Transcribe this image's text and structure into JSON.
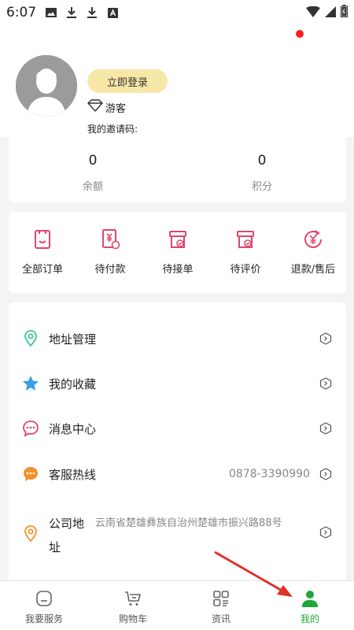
{
  "status_bar": {
    "time": "6:07"
  },
  "profile": {
    "login_label": "立即登录",
    "guest_label": "游客",
    "invite_label": "我的邀请码:"
  },
  "balance": {
    "items": [
      {
        "value": "0",
        "label": "余额"
      },
      {
        "value": "0",
        "label": "积分"
      }
    ]
  },
  "orders": {
    "items": [
      {
        "label": "全部订单",
        "icon": "all-orders-icon"
      },
      {
        "label": "待付款",
        "icon": "pending-payment-icon"
      },
      {
        "label": "待接单",
        "icon": "pending-accept-icon"
      },
      {
        "label": "待评价",
        "icon": "pending-review-icon"
      },
      {
        "label": "退款/售后",
        "icon": "refund-icon"
      }
    ],
    "accent_color": "#e0466a"
  },
  "menu": {
    "items": [
      {
        "label": "地址管理",
        "value": "",
        "icon": "location-icon"
      },
      {
        "label": "我的收藏",
        "value": "",
        "icon": "star-icon"
      },
      {
        "label": "消息中心",
        "value": "",
        "icon": "message-icon"
      },
      {
        "label": "客服热线",
        "value": "0878-3390990",
        "icon": "service-chat-icon"
      }
    ],
    "address": {
      "label": "公司地址",
      "value": "云南省楚雄彝族自治州楚雄市振兴路88号",
      "icon": "map-pin-icon"
    }
  },
  "tabbar": {
    "items": [
      {
        "label": "我要服务",
        "icon": "service-icon"
      },
      {
        "label": "购物车",
        "icon": "cart-icon"
      },
      {
        "label": "资讯",
        "icon": "news-icon"
      },
      {
        "label": "我的",
        "icon": "profile-icon"
      }
    ],
    "active_index": 3,
    "active_color": "#1fa838"
  }
}
